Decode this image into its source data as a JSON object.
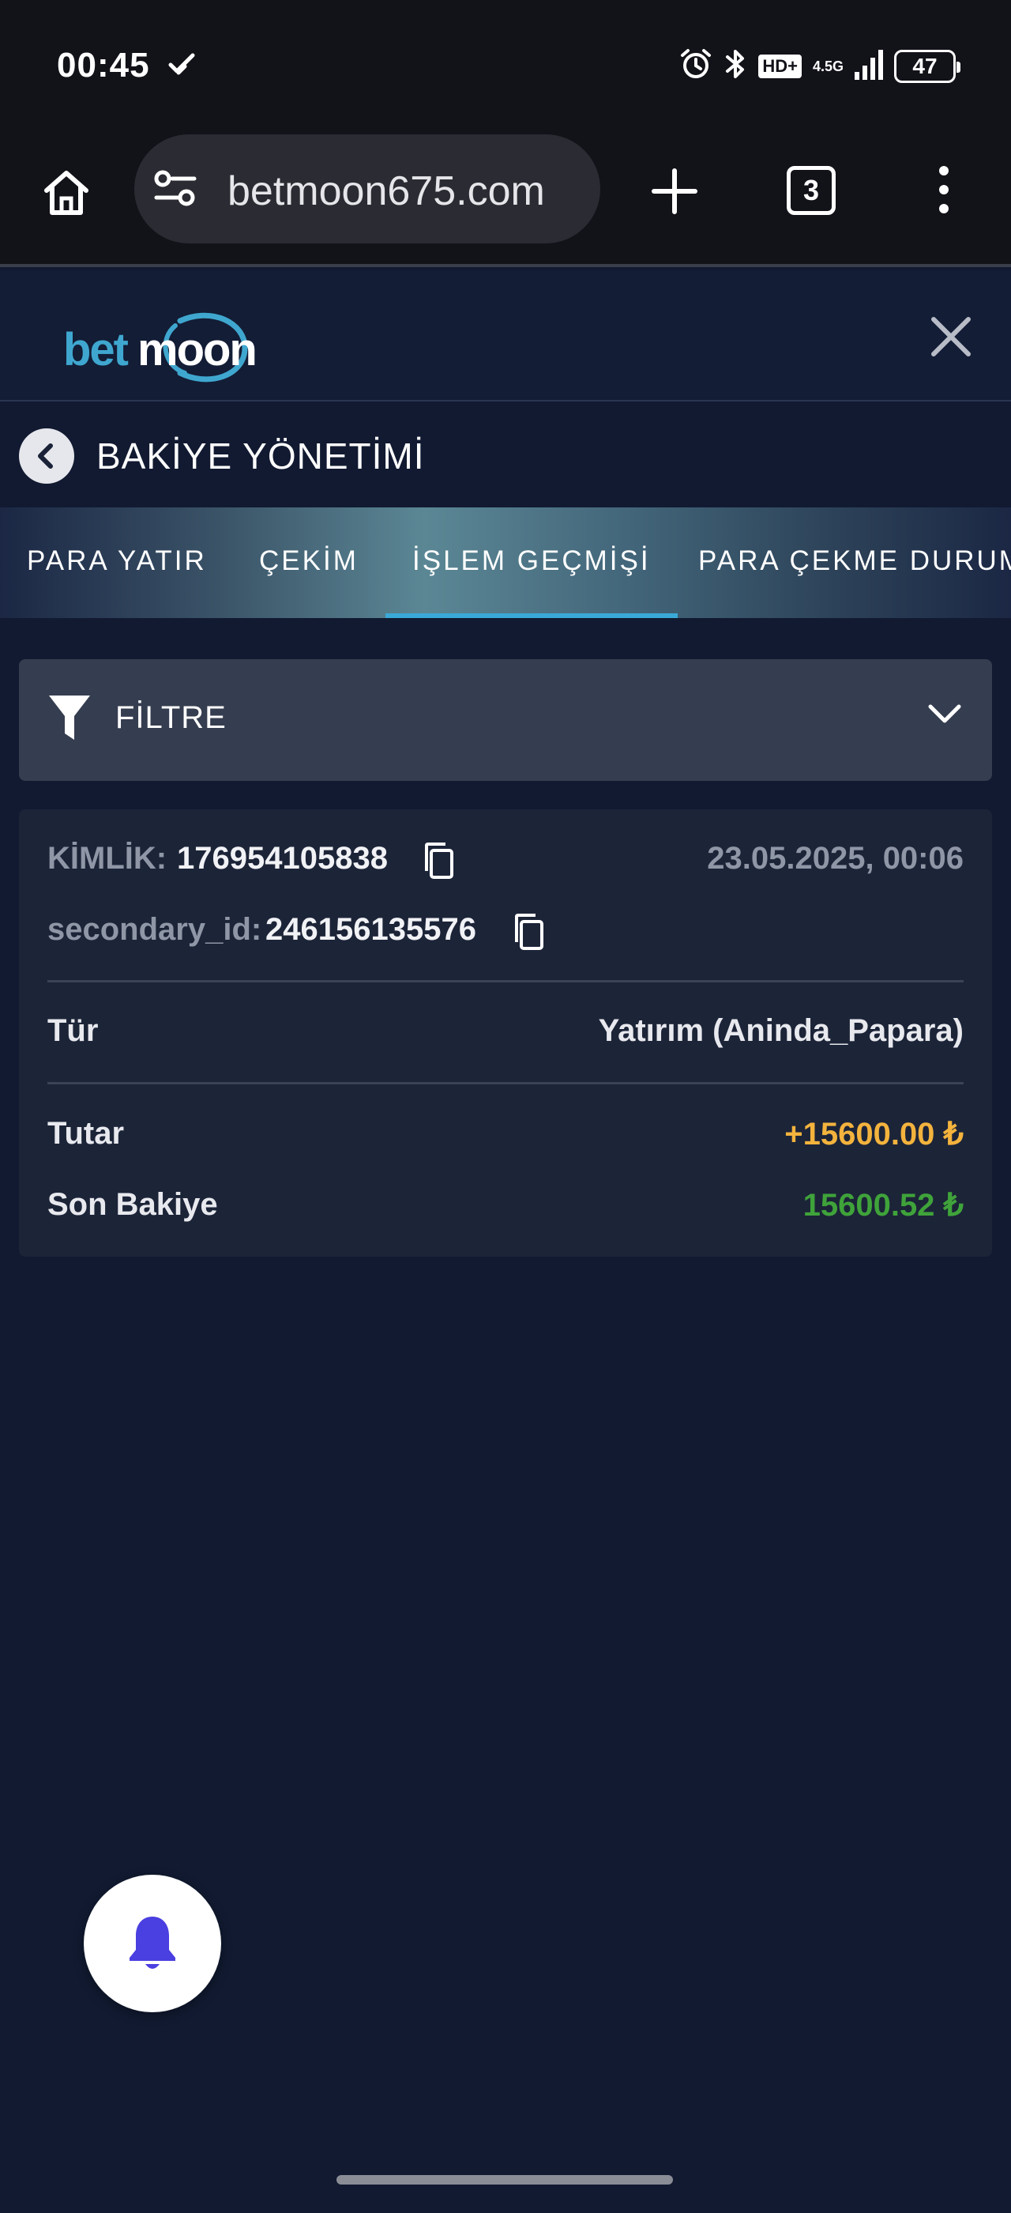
{
  "status_bar": {
    "time": "00:45",
    "network": "4.5G",
    "hd_label": "HD+",
    "battery": "47"
  },
  "browser": {
    "url": "betmoon675.com",
    "tab_count": "3"
  },
  "site": {
    "logo_text_bet": "bet",
    "logo_text_moon": "moon",
    "logo_colors": {
      "bet": "#3fa7cf",
      "moon": "#ffffff"
    }
  },
  "page": {
    "title": "BAKİYE YÖNETİMİ"
  },
  "tabs": [
    {
      "label": "PARA YATIR",
      "active": false
    },
    {
      "label": "ÇEKİM",
      "active": false
    },
    {
      "label": "İŞLEM GEÇMİŞİ",
      "active": true
    },
    {
      "label": "PARA ÇEKME DURUMU",
      "active": false
    }
  ],
  "filter": {
    "label": "FİLTRE"
  },
  "transaction": {
    "id_label": "KİMLİK:",
    "id_value": "176954105838",
    "secondary_label": "secondary_id:",
    "secondary_value": "246156135576",
    "date": "23.05.2025, 00:06",
    "type_label": "Tür",
    "type_value": "Yatırım (Aninda_Papara)",
    "amount_label": "Tutar",
    "amount_value": "+15600.00 ₺",
    "balance_label": "Son Bakiye",
    "balance_value": "15600.52 ₺"
  },
  "colors": {
    "background": "#111a31",
    "amount": "#f3b33d",
    "balance": "#3fa33a",
    "tab_indicator": "#3aa9d8",
    "bell": "#4a3fe0"
  },
  "icons": [
    "home-icon",
    "tune-icon",
    "plus-icon",
    "tabs-icon",
    "more-vert-icon",
    "close-icon",
    "chevron-left-icon",
    "funnel-icon",
    "chevron-down-icon",
    "copy-icon",
    "bell-icon"
  ]
}
